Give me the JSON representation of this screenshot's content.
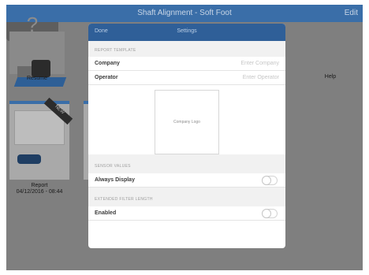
{
  "app": {
    "title": "Shaft Alignment - Soft Foot",
    "edit_label": "Edit",
    "resume_label": "Resume",
    "help_label": "Help",
    "help_glyph": "?",
    "report_label_line1": "Report",
    "report_label_line2": "04/12/2016 - 08:44",
    "report_badge": "NEW"
  },
  "modal": {
    "done_label": "Done",
    "title": "Settings",
    "report_template_header": "REPORT TEMPLATE",
    "company_label": "Company",
    "company_placeholder": "Enter Company",
    "operator_label": "Operator",
    "operator_placeholder": "Enter Operator",
    "logo_label": "Company Logo",
    "sensor_values_header": "SENSOR VALUES",
    "always_display_label": "Always Display",
    "always_display_on": false,
    "extended_header": "EXTENDED FILTER LENGTH",
    "enabled_label": "Enabled",
    "enabled_on": false
  },
  "colors": {
    "header_blue": "#2f5f98",
    "overlay_gray": "#7f7f7f"
  }
}
